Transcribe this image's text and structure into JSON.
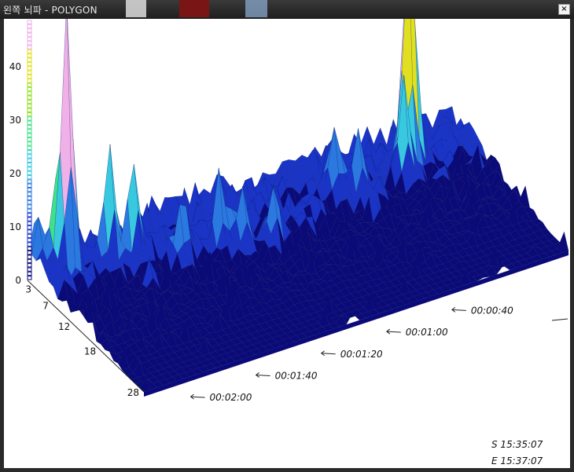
{
  "window": {
    "title": "왼쪽 뇌파 - POLYGON",
    "close_symbol": "×",
    "close_icon": "close-icon"
  },
  "chart_data": {
    "type": "surface",
    "z_ticks": [
      "0",
      "10",
      "20",
      "30",
      "40"
    ],
    "z_range": [
      0,
      48
    ],
    "channel_ticks": [
      "3",
      "7",
      "12",
      "18",
      "28"
    ],
    "channel_range": [
      1,
      28
    ],
    "time_ticks": [
      "00:00:40",
      "00:01:00",
      "00:01:20",
      "00:01:40",
      "00:02:00"
    ],
    "time_range_seconds": [
      0,
      130
    ],
    "start_label": "S 15:35:07",
    "end_label": "E 15:37:07",
    "colormap": [
      "#0a0a78",
      "#1a34c8",
      "#2a78e0",
      "#38c8e0",
      "#40e08a",
      "#90e020",
      "#e0e020",
      "#f0b0e8",
      "#d880c8"
    ],
    "peaks": [
      {
        "channel": 4,
        "time": 122,
        "value": 47
      },
      {
        "channel": 5,
        "time": 110,
        "value": 19
      },
      {
        "channel": 6,
        "time": 104,
        "value": 18
      },
      {
        "channel": 9,
        "time": 93,
        "value": 13
      },
      {
        "channel": 9,
        "time": 82,
        "value": 12
      },
      {
        "channel": 10,
        "time": 76,
        "value": 11
      },
      {
        "channel": 11,
        "time": 68,
        "value": 9
      },
      {
        "channel": 7,
        "time": 44,
        "value": 14
      },
      {
        "channel": 8,
        "time": 38,
        "value": 11
      },
      {
        "channel": 6,
        "time": 20,
        "value": 34
      },
      {
        "channel": 5,
        "time": 18,
        "value": 32
      },
      {
        "channel": 8,
        "time": 24,
        "value": 16
      },
      {
        "channel": 3,
        "time": 125,
        "value": 6
      },
      {
        "channel": 2,
        "time": 128,
        "value": 7
      }
    ]
  }
}
